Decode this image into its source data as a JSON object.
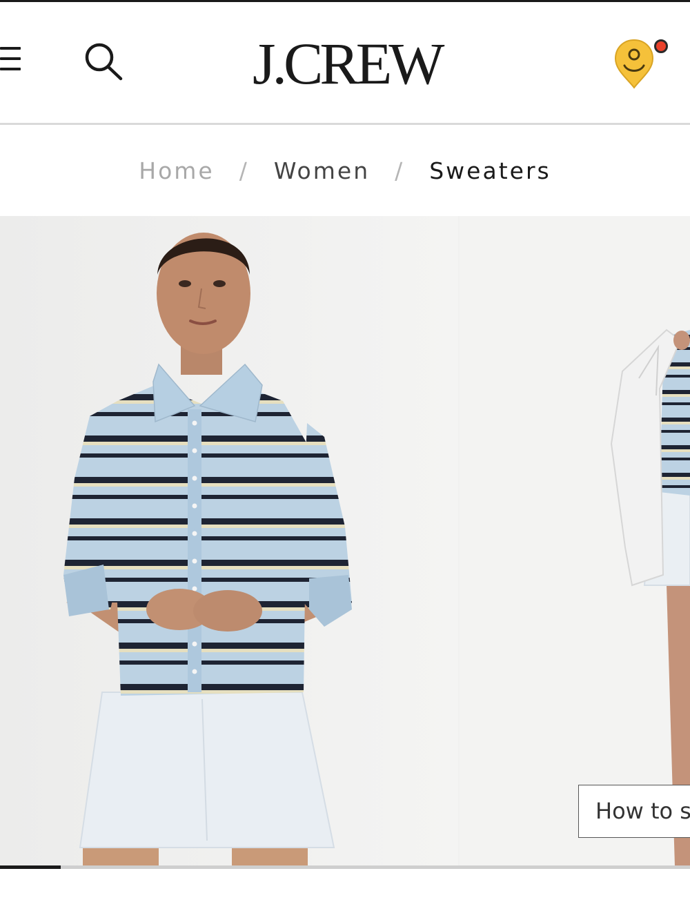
{
  "header": {
    "logo_text": "J.CREW",
    "menu_icon": "hamburger-menu-icon",
    "search_icon": "search-icon",
    "account_icon": "account-avatar-icon",
    "account_icon_color": "#f5c13a",
    "notification_color": "#e9412b"
  },
  "breadcrumb": {
    "items": [
      {
        "label": "Home"
      },
      {
        "label": "Women"
      },
      {
        "label": "Sweaters"
      }
    ],
    "separator": "/"
  },
  "gallery": {
    "slides": [
      {
        "label": "Model in striped polo cardigan sweater and white mini skirt"
      },
      {
        "label": "Model holding white blazer over striped sweater"
      }
    ],
    "cta_label": "How to s",
    "progress": 0.088
  },
  "colors": {
    "stripe_light_blue": "#bcd2e3",
    "stripe_navy": "#1e2433",
    "stripe_cream": "#e6dfbf"
  }
}
